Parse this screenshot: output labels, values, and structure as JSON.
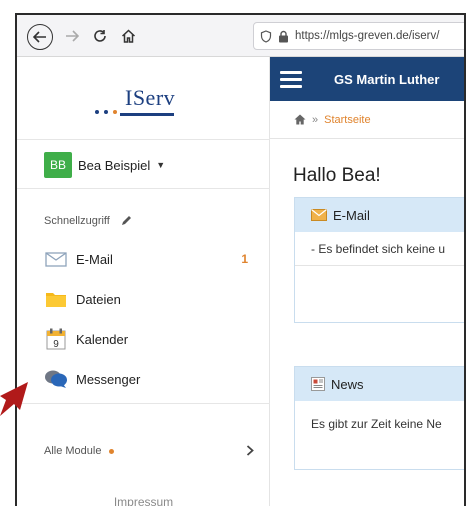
{
  "browser": {
    "url": "https://mlgs-greven.de/iserv/"
  },
  "logo": {
    "text": "IServ",
    "dot_colors": [
      "#1c3f80",
      "#1c3f80",
      "#e0842e"
    ]
  },
  "user": {
    "initials": "BB",
    "name": "Bea Beispiel"
  },
  "sidebar": {
    "quick_access_label": "Schnellzugriff",
    "items": [
      {
        "label": "E-Mail",
        "icon": "envelope-icon",
        "badge": "1"
      },
      {
        "label": "Dateien",
        "icon": "folder-icon"
      },
      {
        "label": "Kalender",
        "icon": "calendar-icon",
        "calendar_day": "9"
      },
      {
        "label": "Messenger",
        "icon": "chat-bubbles-icon"
      }
    ],
    "all_modules_label": "Alle Module",
    "impressum_label": "Impressum"
  },
  "topnav": {
    "title": "GS Martin Luther"
  },
  "breadcrumb": {
    "separator": "»",
    "current": "Startseite"
  },
  "main": {
    "greeting": "Hallo Bea!",
    "email_panel": {
      "title": "E-Mail",
      "message": "- Es befindet sich keine u"
    },
    "news_panel": {
      "title": "News",
      "message": "Es gibt zur Zeit keine Ne"
    }
  },
  "colors": {
    "accent": "#e0842e",
    "nav": "#1c4478",
    "panel_header": "#d6e8f7",
    "user_avatar": "#3fae49",
    "annotation_arrow": "#b11a1a"
  }
}
